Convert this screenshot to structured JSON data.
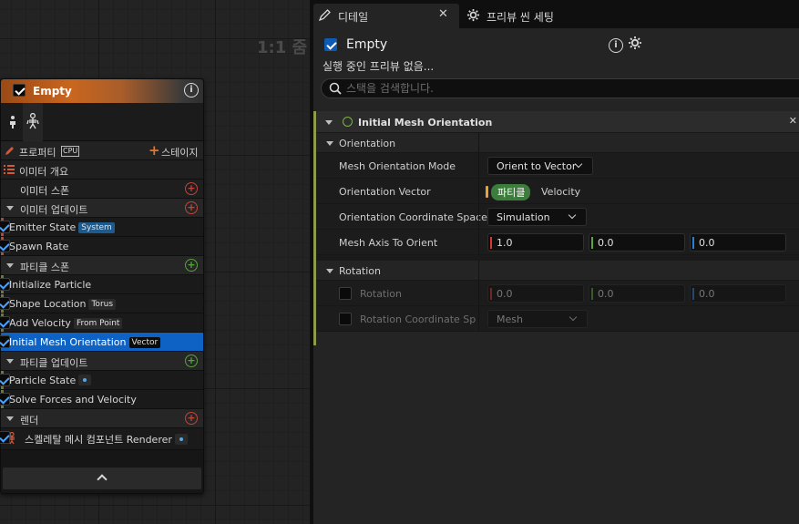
{
  "graph": {
    "zoom_label": "1:1 줌"
  },
  "node": {
    "title": "Empty",
    "header_labels": {
      "properties": "프로퍼티",
      "cpu": "CPU",
      "stage": "스테이지"
    },
    "sections": [
      {
        "label": "이미터 개요"
      },
      {
        "label": "이미터 스폰"
      },
      {
        "label": "이미터 업데이트"
      },
      {
        "label": "파티클 스폰"
      },
      {
        "label": "파티클 업데이트"
      },
      {
        "label": "렌더"
      }
    ],
    "modules": {
      "emitter_state": {
        "label": "Emitter State",
        "tag": "System"
      },
      "spawn_rate": {
        "label": "Spawn Rate"
      },
      "initialize_particle": {
        "label": "Initialize Particle"
      },
      "shape_location": {
        "label": "Shape Location",
        "tag": "Torus"
      },
      "add_velocity": {
        "label": "Add Velocity",
        "tag": "From Point"
      },
      "initial_mesh_orientation": {
        "label": "Initial Mesh Orientation",
        "tag": "Vector"
      },
      "particle_state": {
        "label": "Particle State"
      },
      "solve_forces": {
        "label": "Solve Forces and Velocity"
      },
      "renderer": {
        "label": "스켈레탈 메시 컴포넌트 Renderer"
      }
    }
  },
  "details": {
    "tabs": [
      {
        "label": "디테일",
        "close": "✕"
      },
      {
        "label": "프리뷰 씬 세팅"
      }
    ],
    "object_name": "Empty",
    "preview_note": "실행 중인 프리뷰 없음...",
    "search_placeholder": "스택을 검색합니다.",
    "category": "Initial Mesh Orientation",
    "groups": {
      "orientation": "Orientation",
      "rotation": "Rotation"
    },
    "properties": {
      "mesh_orientation_mode": {
        "label": "Mesh Orientation Mode",
        "value": "Orient to Vector"
      },
      "orientation_vector": {
        "label": "Orientation Vector",
        "param": "파티클",
        "value": "Velocity"
      },
      "orientation_coordinate_space": {
        "label": "Orientation Coordinate Space",
        "value": "Simulation"
      },
      "mesh_axis_to_orient": {
        "label": "Mesh Axis To Orient",
        "x": "1.0",
        "y": "0.0",
        "z": "0.0"
      },
      "rotation": {
        "label": "Rotation",
        "x": "0.0",
        "y": "0.0",
        "z": "0.0"
      },
      "rotation_coordinate_space": {
        "label": "Rotation Coordinate Spac",
        "value": "Mesh"
      }
    }
  },
  "colors": {
    "selection": "#0d62c4",
    "accent_orange": "#c9661f",
    "axis_x": "#d03a32",
    "axis_y": "#5fa53b",
    "axis_z": "#2f7fd1",
    "module_bar_green": "#6b7a3a"
  }
}
